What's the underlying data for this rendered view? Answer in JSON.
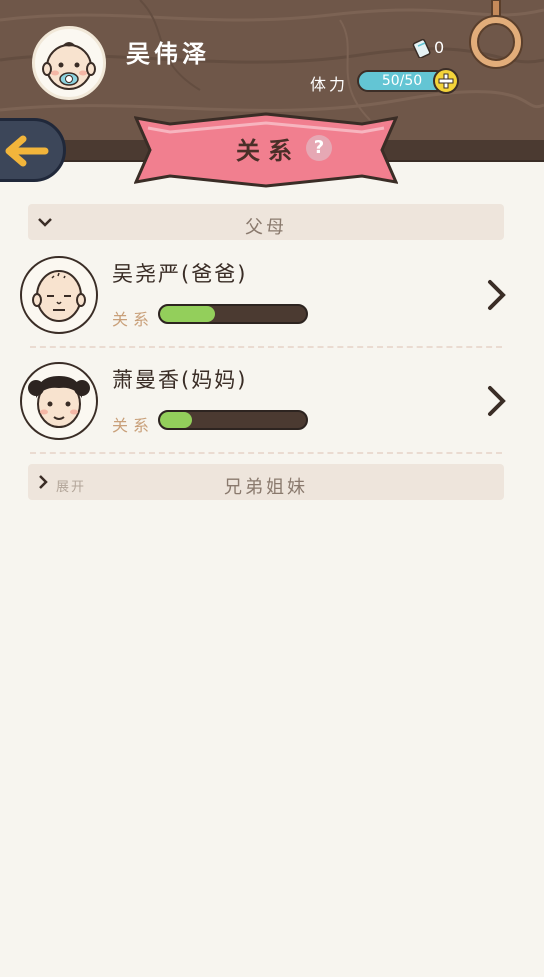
{
  "player": {
    "name": "吴伟泽",
    "ticket_count": "0"
  },
  "stamina": {
    "label": "体力",
    "value": "50/50",
    "current": 50,
    "max": 50
  },
  "page": {
    "title": "关系",
    "help_symbol": "?"
  },
  "sections": [
    {
      "title": "父母",
      "expanded": true,
      "members": [
        {
          "name": "吴尧严(爸爸)",
          "relation_label": "关系",
          "relation_level": 0.38
        },
        {
          "name": "萧曼香(妈妈)",
          "relation_label": "关系",
          "relation_level": 0.22
        }
      ]
    },
    {
      "title": "兄弟姐妹",
      "expanded": false,
      "toggle_label": "展开"
    }
  ],
  "colors": {
    "header_wood": "#6f5749",
    "ribbon_pink": "#f17f8f",
    "stamina_blue": "#63c5d4",
    "relation_green": "#93cf5b",
    "back_arrow": "#f2b53b"
  },
  "icons": [
    "ticket-icon",
    "ring-icon",
    "plus-icon",
    "back-arrow-icon",
    "help-icon",
    "chevron-down-icon",
    "chevron-right-icon"
  ]
}
